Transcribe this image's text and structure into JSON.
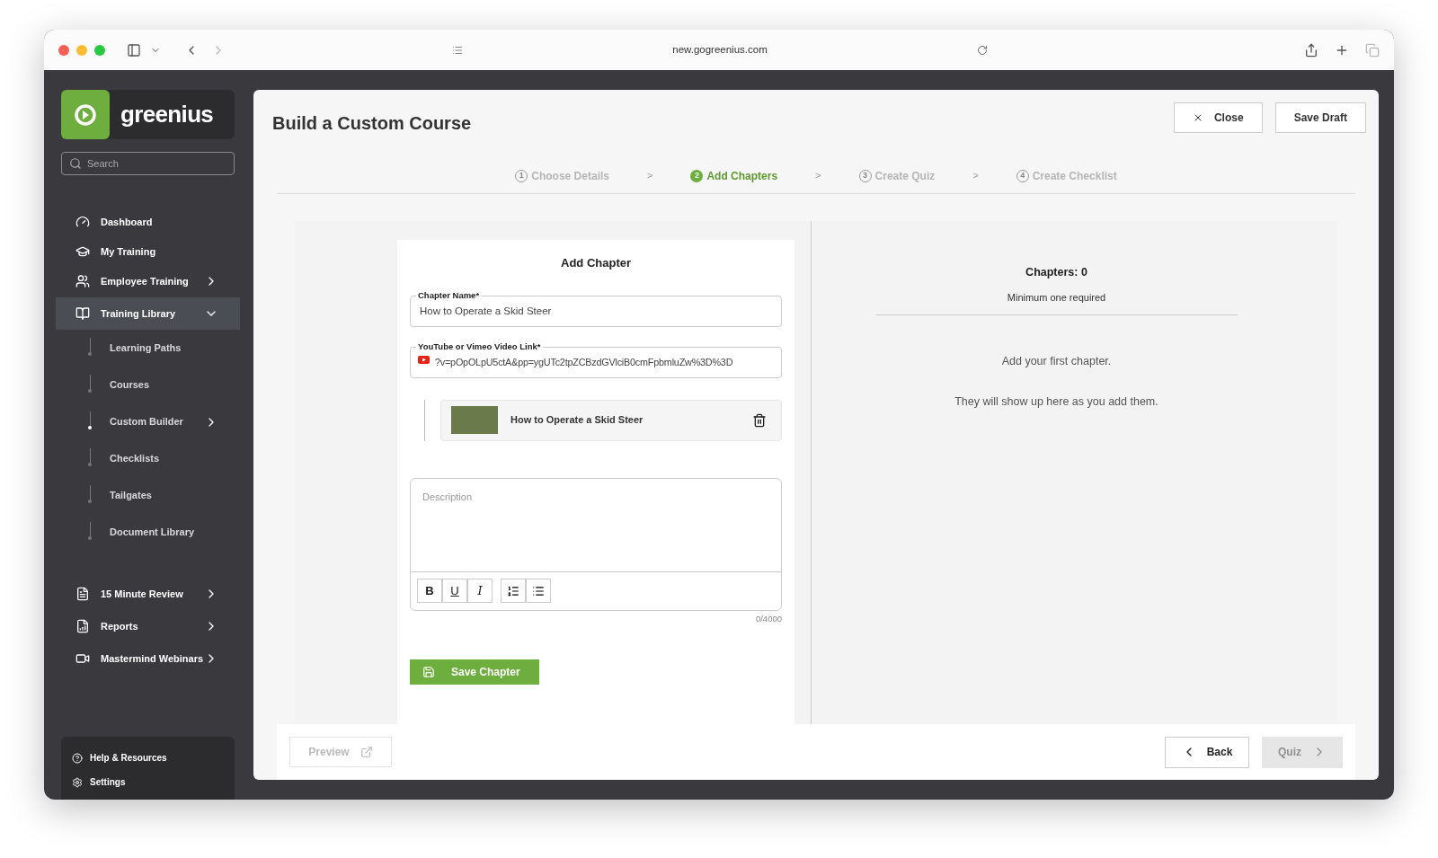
{
  "browser": {
    "url": "new.gogreenius.com"
  },
  "sidebar": {
    "logo_text": "greenius",
    "search": {
      "placeholder": "Search"
    },
    "items": [
      {
        "label": "Dashboard",
        "selected": false
      },
      {
        "label": "My Training",
        "selected": false
      },
      {
        "label": "Employee Training",
        "selected": false,
        "expanded": false
      },
      {
        "label": "Training Library",
        "selected": true,
        "expanded": true,
        "children": [
          {
            "label": "Learning Paths",
            "selected": false
          },
          {
            "label": "Courses",
            "selected": false
          },
          {
            "label": "Custom Builder",
            "selected": true,
            "expanded": false
          },
          {
            "label": "Checklists",
            "selected": false
          },
          {
            "label": "Tailgates",
            "selected": false
          },
          {
            "label": "Document Library",
            "selected": false
          }
        ]
      },
      {
        "label": "15 Minute Review",
        "selected": false,
        "expanded": false
      },
      {
        "label": "Reports",
        "selected": false,
        "expanded": false
      },
      {
        "label": "Mastermind Webinars",
        "selected": false,
        "expanded": false
      }
    ],
    "footer": [
      {
        "label": "Help & Resources"
      },
      {
        "label": "Settings"
      }
    ]
  },
  "header": {
    "title": "Build a Custom Course",
    "buttons": [
      {
        "label": "Close",
        "kind": "close"
      },
      {
        "label": "Save Draft",
        "kind": "plain"
      }
    ]
  },
  "steps": [
    {
      "number": "1",
      "label": "Choose Details",
      "selected": false
    },
    {
      "number": "2",
      "label": "Add Chapters",
      "selected": true
    },
    {
      "number": "3",
      "label": "Create Quiz",
      "selected": false
    },
    {
      "number": "4",
      "label": "Create Checklist",
      "selected": false
    }
  ],
  "step_separators": [
    ">",
    ">",
    ">"
  ],
  "form": {
    "heading": "Add Chapter",
    "chapter_name": {
      "label": "Chapter Name*",
      "value": "How to Operate a Skid Steer"
    },
    "video_link": {
      "label": "YouTube or Vimeo Video Link*",
      "value": "?v=pOpOLpU5ctA&pp=ygUTc2tpZCBzdGVlciB0cmFpbmluZw%3D%3D"
    },
    "video_item": {
      "title": "How to Operate a Skid Steer"
    },
    "description": {
      "placeholder": "Description",
      "counter": "0/4000"
    },
    "format_buttons": [
      {
        "label": "B",
        "kind": "bold"
      },
      {
        "label": "U",
        "kind": "underline"
      },
      {
        "label": "I",
        "kind": "italic"
      }
    ],
    "save_button": "Save Chapter"
  },
  "chapters_panel": {
    "title": "Chapters: 0",
    "subtitle": "Minimum one required",
    "empty_title": "Add your first chapter.",
    "empty_text": "They will show up here as you add them."
  },
  "footer": {
    "preview": {
      "label": "Preview",
      "disabled": true
    },
    "back": {
      "label": "Back"
    },
    "next": {
      "label": "Quiz",
      "disabled": true
    }
  }
}
